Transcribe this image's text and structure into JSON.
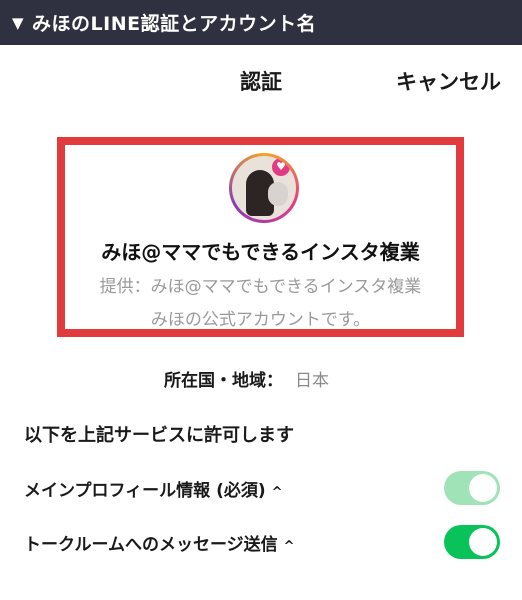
{
  "header": {
    "collapse_glyph": "▼",
    "title": "みほのLINE認証とアカウント名"
  },
  "topbar": {
    "title": "認証",
    "cancel_label": "キャンセル"
  },
  "account": {
    "name": "みほ@ママでもできるインスタ複業",
    "provider": "提供：みほ@ママでもできるインスタ複業",
    "description": "みほの公式アカウントです。",
    "highlight_color": "#e23b3e"
  },
  "region": {
    "label": "所在国・地域：",
    "value": "日本"
  },
  "permissions": {
    "heading": "以下を上記サービスに許可します",
    "items": [
      {
        "label": "メインプロフィール情報 (必須)",
        "chevron": "^",
        "toggle_on": true,
        "toggle_disabled": true
      },
      {
        "label": "トークルームへのメッセージ送信",
        "chevron": "^",
        "toggle_on": true,
        "toggle_disabled": false
      }
    ]
  },
  "colors": {
    "toggle_on": "#08c35a",
    "toggle_disabled": "#9fe3b6",
    "header_bg": "#2f3140"
  }
}
